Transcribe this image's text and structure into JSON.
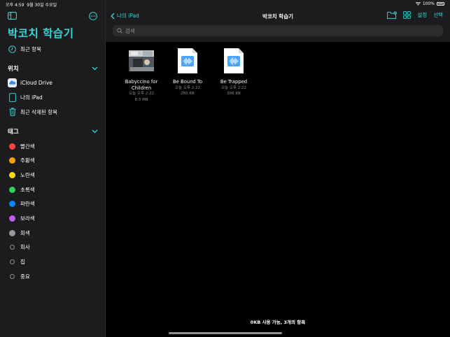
{
  "status_bar": {
    "time": "오후 4:59",
    "date": "9월 30일 수요일",
    "battery": "100%"
  },
  "sidebar": {
    "title": "박코치 학습기",
    "recents": "최근 항목",
    "locations": {
      "header": "위치",
      "items": [
        {
          "label": "iCloud Drive",
          "icon": "icloud-icon"
        },
        {
          "label": "나의 iPad",
          "icon": "ipad-icon"
        },
        {
          "label": "최근 삭제된 항목",
          "icon": "trash-icon"
        }
      ]
    },
    "tags": {
      "header": "태그",
      "items": [
        {
          "label": "빨간색",
          "color": "#ff453a"
        },
        {
          "label": "주황색",
          "color": "#ff9f0a"
        },
        {
          "label": "노란색",
          "color": "#ffd60a"
        },
        {
          "label": "초록색",
          "color": "#30d158"
        },
        {
          "label": "파란색",
          "color": "#0a84ff"
        },
        {
          "label": "보라색",
          "color": "#bf5af2"
        },
        {
          "label": "회색",
          "color": "#98989d"
        },
        {
          "label": "회사",
          "color": ""
        },
        {
          "label": "집",
          "color": ""
        },
        {
          "label": "중요",
          "color": ""
        }
      ]
    }
  },
  "navbar": {
    "back_label": "나의 iPad",
    "title": "박코치 학습기",
    "settings_label": "설정",
    "select_label": "선택"
  },
  "search": {
    "placeholder": "검색"
  },
  "files": [
    {
      "name_line1": "Babyccino for",
      "name_line2": "Children",
      "date": "오늘 오후 2:22",
      "size": "8.3 MB",
      "kind": "video"
    },
    {
      "name_line1": "Be Bound To",
      "name_line2": "",
      "date": "오늘 오후 2:22",
      "size": "285 KB",
      "kind": "audio"
    },
    {
      "name_line1": "Be Trapped",
      "name_line2": "",
      "date": "오늘 오후 2:22",
      "size": "306 KB",
      "kind": "audio"
    }
  ],
  "footer": {
    "status": "0KB 사용 가능, 3개의 항목"
  },
  "colors": {
    "accent": "#33d3d3",
    "sidebar_bg": "#1c1c1e",
    "main_bg": "#000000"
  }
}
